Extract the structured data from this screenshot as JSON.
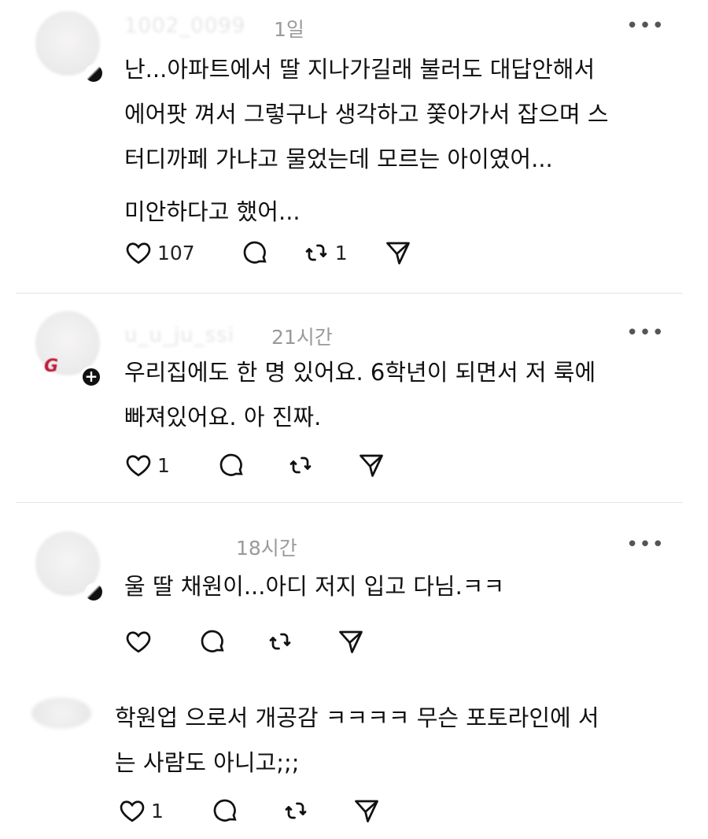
{
  "posts": [
    {
      "username": "1002_0099",
      "time": "1일",
      "lines": [
        "난...아파트에서 딸 지나가길래 불러도 대답안해서",
        "에어팟 껴서 그렇구나 생각하고 쫓아가서 잡으며 스",
        "터디까페 가냐고 물었는데 모르는 아이였어..."
      ],
      "extra_line": "미안하다고 했어...",
      "likes": "107",
      "reposts": "1"
    },
    {
      "username": "u_u_ju_ssi",
      "time": "21시간",
      "avatar_text": "G",
      "badge": "+",
      "lines": [
        "우리집에도 한 명 있어요. 6학년이 되면서 저 룩에",
        "빠져있어요. 아 진짜."
      ],
      "likes": "1"
    },
    {
      "username": "",
      "time": "18시간",
      "lines": [
        "울 딸 채원이...아디 저지 입고 다님.ㅋㅋ"
      ]
    },
    {
      "lines": [
        "학원업 으로서 개공감 ㅋㅋㅋㅋ 무슨 포토라인에 서",
        "는 사람도 아니고;;;"
      ],
      "likes": "1"
    }
  ],
  "icons": {
    "more": "more-horizontal-icon",
    "like": "heart-icon",
    "reply": "comment-bubble-icon",
    "repost": "repost-icon",
    "share": "send-icon"
  },
  "more_label": "•••"
}
